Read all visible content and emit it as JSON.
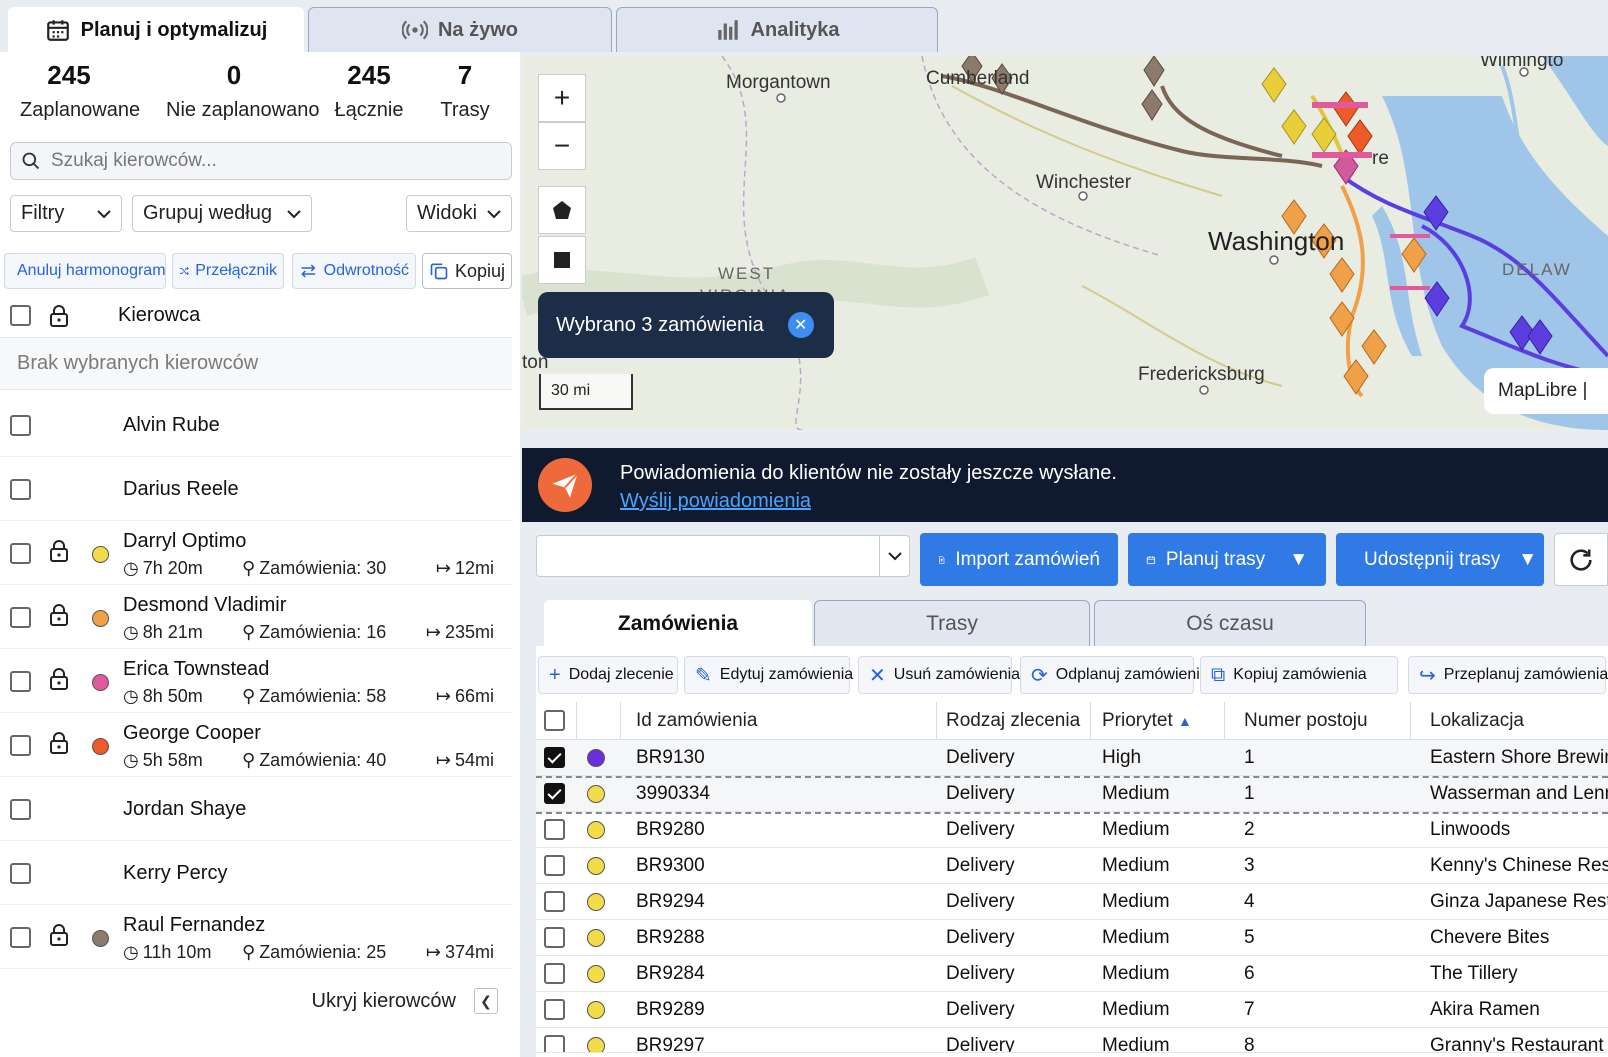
{
  "tabs": {
    "plan": "Planuj i optymalizuj",
    "live": "Na żywo",
    "analytics": "Analityka"
  },
  "stats": [
    {
      "value": "245",
      "label": "Zaplanowane"
    },
    {
      "value": "0",
      "label": "Nie zaplanowano"
    },
    {
      "value": "245",
      "label": "Łącznie"
    },
    {
      "value": "7",
      "label": "Trasy"
    }
  ],
  "search": {
    "placeholder": "Szukaj kierowców..."
  },
  "dropdowns": {
    "filters": "Filtry",
    "group_by": "Grupuj według",
    "views": "Widoki"
  },
  "driver_actions": {
    "unschedule": "Anuluj harmonogram",
    "switch": "Przełącznik",
    "reverse": "Odwrotność",
    "copy": "Kopiuj"
  },
  "driver_header": "Kierowca",
  "no_drivers": "Brak wybranych kierowców",
  "drivers": [
    {
      "name": "Alvin Rube"
    },
    {
      "name": "Darius Reele"
    },
    {
      "name": "Darryl Optimo",
      "color": "#f3dc4a",
      "time": "7h 20m",
      "orders": "Zamówienia: 30",
      "distance": "12mi"
    },
    {
      "name": "Desmond Vladimir",
      "color": "#f0a046",
      "time": "8h 21m",
      "orders": "Zamówienia: 16",
      "distance": "235mi"
    },
    {
      "name": "Erica Townstead",
      "color": "#e05a9c",
      "time": "8h 50m",
      "orders": "Zamówienia: 58",
      "distance": "66mi"
    },
    {
      "name": "George Cooper",
      "color": "#ef5a2a",
      "time": "5h 58m",
      "orders": "Zamówienia: 40",
      "distance": "54mi"
    },
    {
      "name": "Jordan Shaye"
    },
    {
      "name": "Kerry Percy"
    },
    {
      "name": "Raul Fernandez",
      "color": "#8c7a6a",
      "time": "11h 10m",
      "orders": "Zamówienia: 25",
      "distance": "374mi"
    }
  ],
  "hide_drivers": "Ukryj kierowców",
  "map": {
    "labels": {
      "morgantown": "Morgantown",
      "cumberland": "Cumberland",
      "winchester": "Winchester",
      "washington": "Washington",
      "west": "WEST",
      "virginia": "VIRGINIA",
      "fredericksburg": "Fredericksburg",
      "delaware": "DELAW",
      "wilmington": "Wilmingto",
      "baltimore": "re",
      "ton": "ton"
    },
    "selection": "Wybrano 3 zamówienia",
    "scale": "30 mi",
    "attribution": "MapLibre |"
  },
  "notification": {
    "text": "Powiadomienia do klientów nie zostały jeszcze wysłane.",
    "link": "Wyślij powiadomienia"
  },
  "toolbar": {
    "import": "Import zamówień",
    "plan": "Planuj trasy",
    "share": "Udostępnij trasy"
  },
  "bottom_tabs": {
    "orders": "Zamówienia",
    "routes": "Trasy",
    "timeline": "Oś czasu"
  },
  "order_actions": {
    "add": "Dodaj zlecenie",
    "edit": "Edytuj zamówienia",
    "delete": "Usuń zamówienia",
    "unschedule": "Odplanuj zamówienia",
    "copy": "Kopiuj zamówienia",
    "reschedule": "Przeplanuj zamówienia"
  },
  "table": {
    "columns": [
      "Id zamówienia",
      "Rodzaj zlecenia",
      "Priorytet",
      "Numer postoju",
      "Lokalizacja"
    ],
    "rows": [
      {
        "id": "BR9130",
        "type": "Delivery",
        "priority": "High",
        "stop": "1",
        "location": "Eastern Shore Brewing",
        "color": "#6a2de0",
        "checked": true
      },
      {
        "id": "3990334",
        "type": "Delivery",
        "priority": "Medium",
        "stop": "1",
        "location": "Wasserman and Lenn",
        "color": "#f3dc4a",
        "checked": true
      },
      {
        "id": "BR9280",
        "type": "Delivery",
        "priority": "Medium",
        "stop": "2",
        "location": "Linwoods",
        "color": "#f3dc4a",
        "checked": false
      },
      {
        "id": "BR9300",
        "type": "Delivery",
        "priority": "Medium",
        "stop": "3",
        "location": "Kenny's Chinese Rest",
        "color": "#f3dc4a",
        "checked": false
      },
      {
        "id": "BR9294",
        "type": "Delivery",
        "priority": "Medium",
        "stop": "4",
        "location": "Ginza Japanese Rest",
        "color": "#f3dc4a",
        "checked": false
      },
      {
        "id": "BR9288",
        "type": "Delivery",
        "priority": "Medium",
        "stop": "5",
        "location": "Chevere Bites",
        "color": "#f3dc4a",
        "checked": false
      },
      {
        "id": "BR9284",
        "type": "Delivery",
        "priority": "Medium",
        "stop": "6",
        "location": "The Tillery",
        "color": "#f3dc4a",
        "checked": false
      },
      {
        "id": "BR9289",
        "type": "Delivery",
        "priority": "Medium",
        "stop": "7",
        "location": "Akira Ramen",
        "color": "#f3dc4a",
        "checked": false
      },
      {
        "id": "BR9297",
        "type": "Delivery",
        "priority": "Medium",
        "stop": "8",
        "location": "Granny's Restaurant",
        "color": "#f3dc4a",
        "checked": false
      }
    ]
  },
  "colors": {
    "accent": "#2f7ae5",
    "nav_dark": "#1c2d47",
    "notif_bg": "#0f1a2e",
    "notif_icon": "#ef6a3a"
  }
}
